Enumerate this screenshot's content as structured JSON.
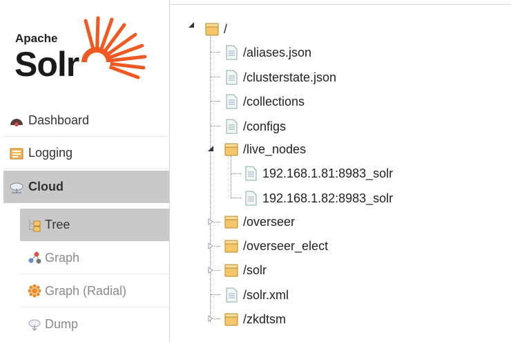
{
  "logo": {
    "apache": "Apache",
    "solr": "Solr"
  },
  "nav": {
    "dashboard": "Dashboard",
    "logging": "Logging",
    "cloud": "Cloud"
  },
  "cloud_sub": {
    "tree": "Tree",
    "graph": "Graph",
    "graph_radial": "Graph (Radial)",
    "dump": "Dump"
  },
  "tree": {
    "root": "/",
    "aliases": "/aliases.json",
    "clusterstate": "/clusterstate.json",
    "collections": "/collections",
    "configs": "/configs",
    "live_nodes": "/live_nodes",
    "node1": "192.168.1.81:8983_solr",
    "node2": "192.168.1.82:8983_solr",
    "overseer": "/overseer",
    "overseer_elect": "/overseer_elect",
    "solr": "/solr",
    "solr_xml": "/solr.xml",
    "zkdtsm": "/zkdtsm"
  },
  "colors": {
    "active_bg": "#c9c9c9",
    "solr_orange": "#f05a22",
    "folder": "#f4c86a"
  }
}
